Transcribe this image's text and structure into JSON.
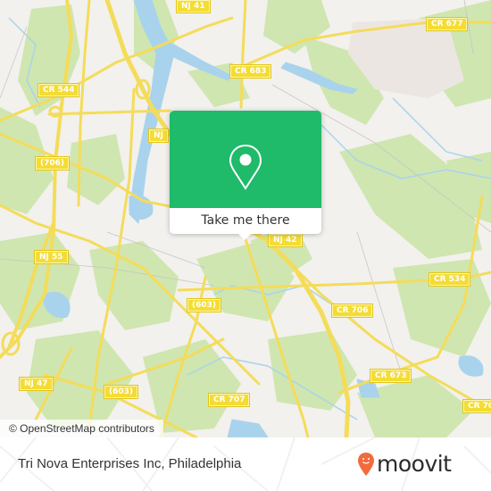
{
  "map": {
    "road_labels": [
      {
        "id": "nj41",
        "text": "NJ 41"
      },
      {
        "id": "cr677",
        "text": "CR 677"
      },
      {
        "id": "cr683",
        "text": "CR 683"
      },
      {
        "id": "cr544",
        "text": "CR 544"
      },
      {
        "id": "nj-partial",
        "text": "NJ"
      },
      {
        "id": "r706",
        "text": "(706)"
      },
      {
        "id": "nj55",
        "text": "NJ 55"
      },
      {
        "id": "nj42",
        "text": "NJ 42"
      },
      {
        "id": "cr534",
        "text": "CR 534"
      },
      {
        "id": "r603a",
        "text": "(603)"
      },
      {
        "id": "cr706",
        "text": "CR 706"
      },
      {
        "id": "nj47",
        "text": "NJ 47"
      },
      {
        "id": "r603b",
        "text": "(603)"
      },
      {
        "id": "cr707",
        "text": "CR 707"
      },
      {
        "id": "cr673",
        "text": "CR 673"
      },
      {
        "id": "cr70x",
        "text": "CR 70"
      }
    ],
    "attribution": "© OpenStreetMap contributors",
    "colors": {
      "land": "#f2f1ee",
      "park": "#cfe6b0",
      "water": "#a9d3ec",
      "road": "#f4dc5a",
      "popup": "#1fba6a"
    }
  },
  "popup": {
    "icon": "location-pin-icon",
    "button_label": "Take me there"
  },
  "footer": {
    "place_name": "Tri Nova Enterprises Inc, Philadelphia",
    "brand": "moovit",
    "brand_color": "#f26a3d"
  }
}
